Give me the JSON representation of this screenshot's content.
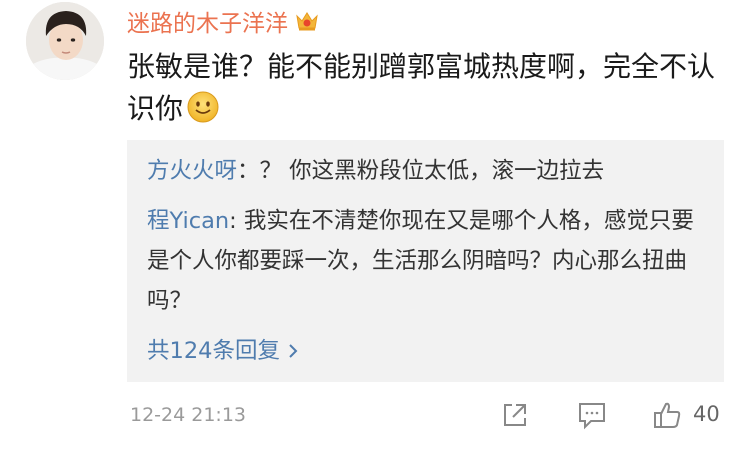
{
  "comment": {
    "username": "迷路的木子洋洋",
    "badge_icon": "crown-icon",
    "text": "张敏是谁？能不能别蹭郭富城热度啊，完全不认识你",
    "emoji_icon": "smile-emoji-icon"
  },
  "replies": [
    {
      "name": "方火火呀",
      "text": "：？ 你这黑粉段位太低，滚一边拉去"
    },
    {
      "name": "程Yican",
      "text": ": 我实在不清楚你现在又是哪个人格，感觉只要是个人你都要踩一次，生活那么阴暗吗？内心那么扭曲吗？"
    }
  ],
  "more_replies_label": "共124条回复",
  "footer": {
    "time": "12-24 21:13",
    "like_count": "40"
  },
  "colors": {
    "username": "#eb7350",
    "link": "#4f7cae",
    "reply_bg": "#f2f2f2",
    "meta": "#9a9a9a"
  }
}
